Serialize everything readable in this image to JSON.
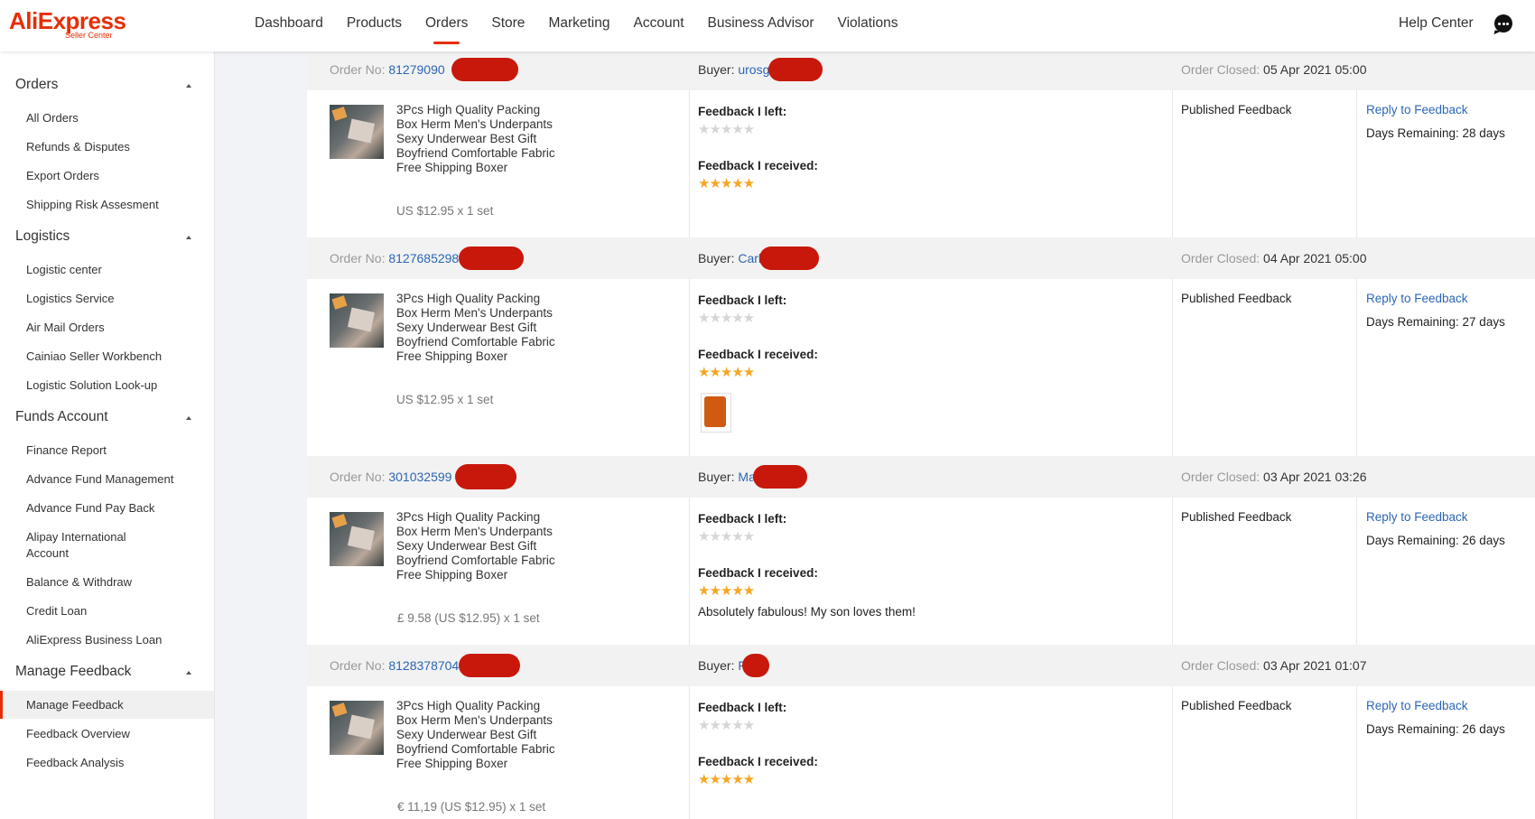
{
  "header": {
    "logo": "AliExpress",
    "logo_sub": "Seller Center",
    "nav": [
      "Dashboard",
      "Products",
      "Orders",
      "Store",
      "Marketing",
      "Account",
      "Business Advisor",
      "Violations"
    ],
    "active_nav": "Orders",
    "help": "Help Center",
    "brand_color": "#e62e04"
  },
  "sidebar": {
    "sections": [
      {
        "title": "Orders",
        "items": [
          "All Orders",
          "Refunds & Disputes",
          "Export Orders",
          "Shipping Risk Assesment"
        ]
      },
      {
        "title": "Logistics",
        "items": [
          "Logistic center",
          "Logistics Service",
          "Air Mail Orders",
          "Cainiao Seller Workbench",
          "Logistic Solution Look-up"
        ]
      },
      {
        "title": "Funds Account",
        "items": [
          "Finance Report",
          "Advance Fund Management",
          "Advance Fund Pay Back",
          "Alipay International Account",
          "Balance & Withdraw",
          "Credit Loan",
          "AliExpress Business Loan"
        ]
      },
      {
        "title": "Manage Feedback",
        "items": [
          "Manage Feedback",
          "Feedback Overview",
          "Feedback Analysis"
        ]
      }
    ],
    "active_item": "Manage Feedback"
  },
  "labels": {
    "order_no": "Order No:",
    "buyer": "Buyer:",
    "order_closed": "Order Closed:",
    "feedback_left": "Feedback I left:",
    "feedback_received": "Feedback I received:",
    "status": "Published Feedback",
    "reply": "Reply to Feedback"
  },
  "orders": [
    {
      "order_no": "81279090",
      "buyer": "urosg",
      "closed": "05 Apr 2021 05:00",
      "product": "3Pcs High Quality Packing Box Herm Men's Underpants Sexy Underwear Best Gift Boyfriend Comfortable Fabric Free Shipping Boxer",
      "price": "US $12.95 x 1 set",
      "left_stars": 0,
      "received_stars": 5,
      "comment": "",
      "has_photo": false,
      "days": "Days Remaining: 28 days"
    },
    {
      "order_no": "8127685298",
      "buyer": "Carl",
      "closed": "04 Apr 2021 05:00",
      "product": "3Pcs High Quality Packing Box Herm Men's Underpants Sexy Underwear Best Gift Boyfriend Comfortable Fabric Free Shipping Boxer",
      "price": "US $12.95 x 1 set",
      "left_stars": 0,
      "received_stars": 5,
      "comment": "",
      "has_photo": true,
      "days": "Days Remaining: 27 days"
    },
    {
      "order_no": "301032599",
      "buyer": "Ma",
      "closed": "03 Apr 2021 03:26",
      "product": "3Pcs High Quality Packing Box Herm Men's Underpants Sexy Underwear Best Gift Boyfriend Comfortable Fabric Free Shipping Boxer",
      "price": "£ 9.58 (US $12.95) x 1 set",
      "left_stars": 0,
      "received_stars": 5,
      "comment": "Absolutely fabulous! My son loves them!",
      "has_photo": false,
      "days": "Days Remaining: 26 days"
    },
    {
      "order_no": "8128378704",
      "buyer": "F",
      "closed": "03 Apr 2021 01:07",
      "product": "3Pcs High Quality Packing Box Herm Men's Underpants Sexy Underwear Best Gift Boyfriend Comfortable Fabric Free Shipping Boxer",
      "price": "€ 11,19 (US $12.95) x 1 set",
      "left_stars": 0,
      "received_stars": 5,
      "comment": "",
      "has_photo": false,
      "days": "Days Remaining: 26 days"
    }
  ]
}
